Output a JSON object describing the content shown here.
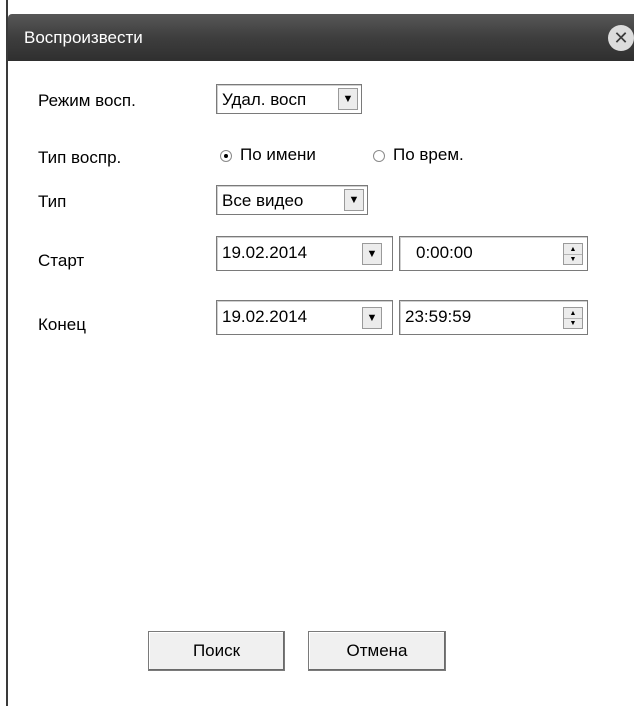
{
  "window": {
    "title": "Воспроизвести"
  },
  "fields": {
    "mode_label": "Режим восп.",
    "mode_value": "Удал. восп",
    "playtype_label": "Тип воспр.",
    "playtype_options": [
      "По имени",
      "По врем."
    ],
    "playtype_selected": "По имени",
    "type_label": "Тип",
    "type_value": "Все видео",
    "start_label": "Старт",
    "start_date": "19.02.2014",
    "start_time": "0:00:00",
    "end_label": "Конец",
    "end_date": "19.02.2014",
    "end_time": "23:59:59"
  },
  "buttons": {
    "search": "Поиск",
    "cancel": "Отмена"
  },
  "icons": {
    "close": "close-icon",
    "dropdown": "chevron-down-icon",
    "spin_up": "spin-up-icon",
    "spin_down": "spin-down-icon"
  }
}
